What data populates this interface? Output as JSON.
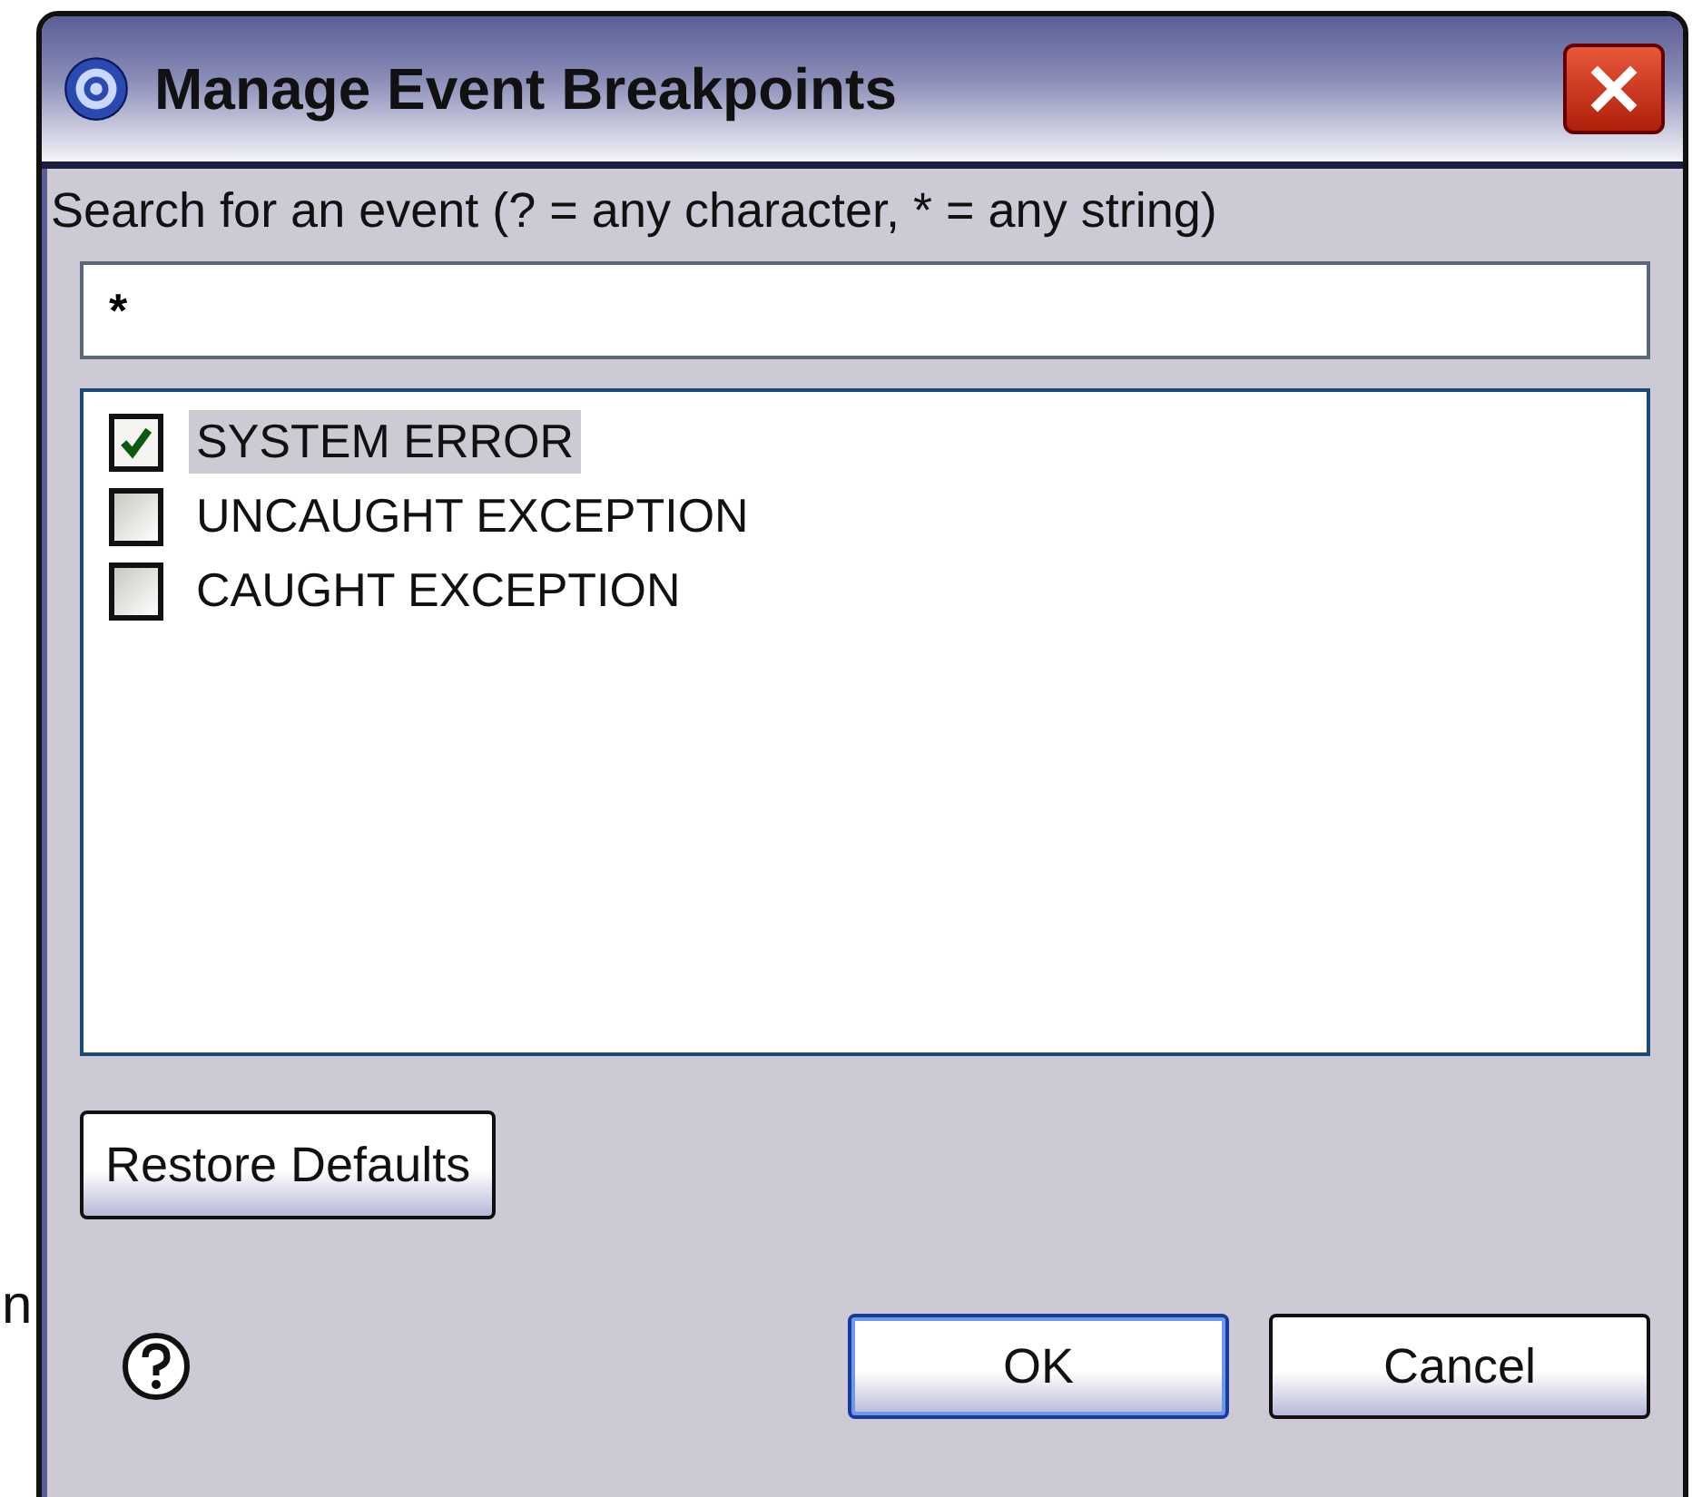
{
  "background_text": "n",
  "window": {
    "title": "Manage Event Breakpoints"
  },
  "search": {
    "label": "Search for an event (? = any character, * = any string)",
    "value": "*"
  },
  "events": [
    {
      "label": "SYSTEM ERROR",
      "checked": true,
      "selected": true
    },
    {
      "label": "UNCAUGHT EXCEPTION",
      "checked": false,
      "selected": false
    },
    {
      "label": "CAUGHT EXCEPTION",
      "checked": false,
      "selected": false
    }
  ],
  "restore_button": "Restore Defaults",
  "buttons": [
    {
      "label": "OK",
      "kind": "default"
    },
    {
      "label": "Cancel",
      "kind": "normal"
    }
  ]
}
